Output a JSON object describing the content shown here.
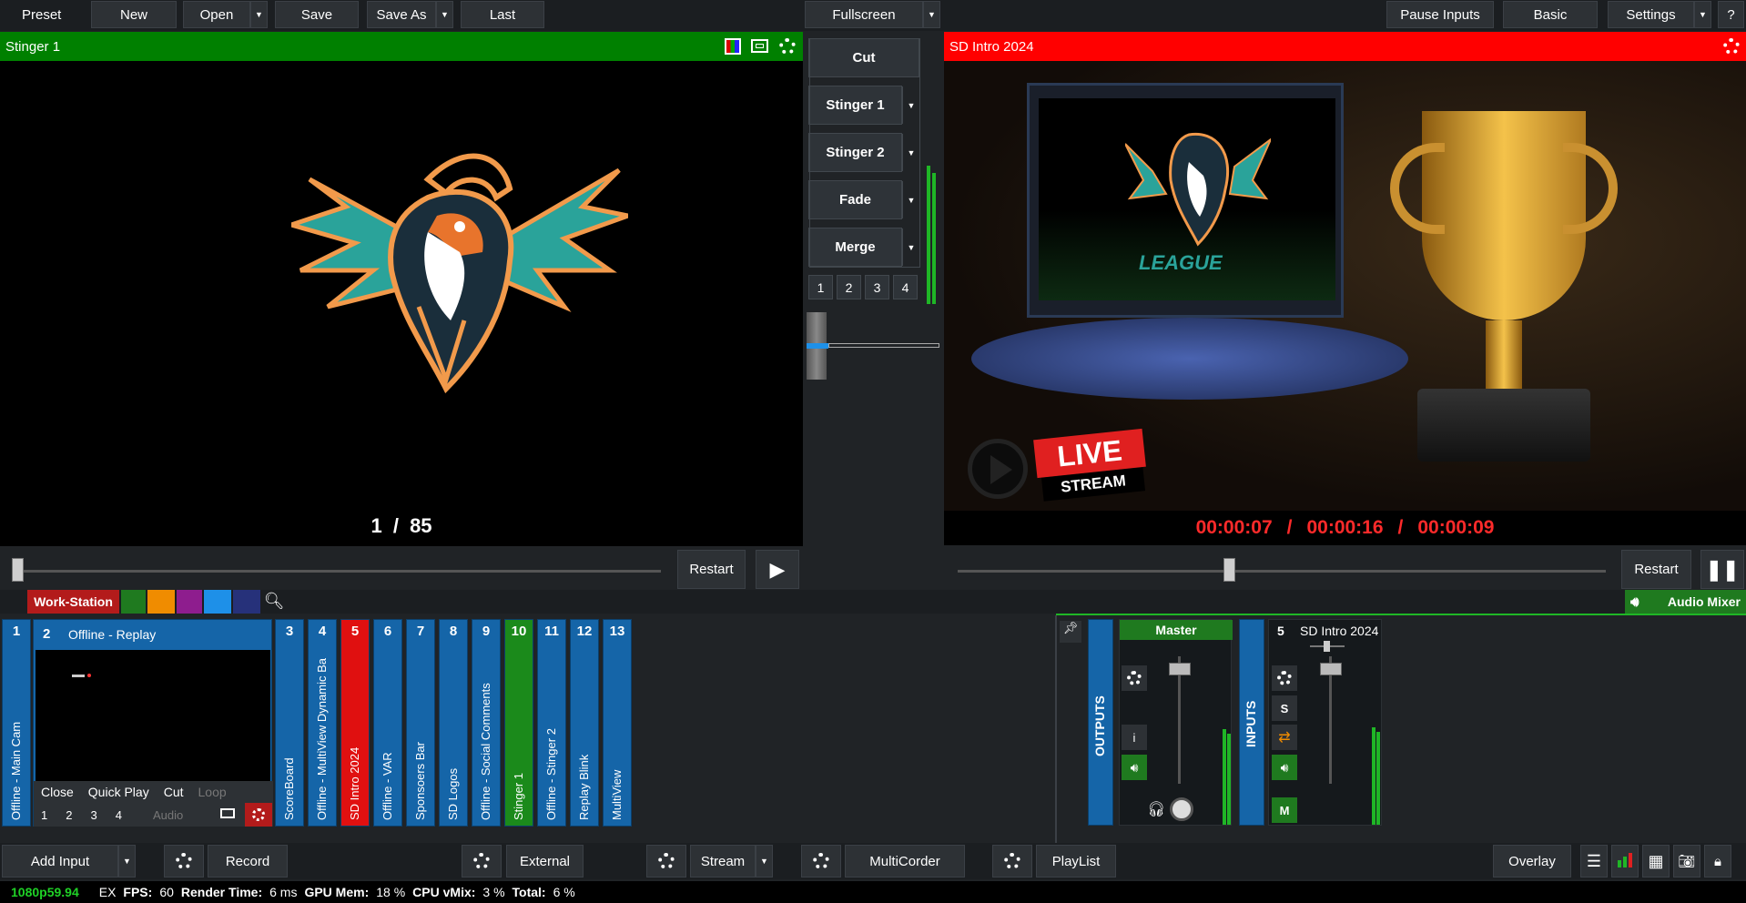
{
  "topbar": {
    "preset": "Preset",
    "new": "New",
    "open": "Open",
    "save": "Save",
    "save_as": "Save As",
    "last": "Last",
    "fullscreen": "Fullscreen",
    "pause_inputs": "Pause Inputs",
    "basic": "Basic",
    "settings": "Settings",
    "help": "?"
  },
  "preview": {
    "title": "Stinger 1",
    "counter_current": "1",
    "counter_sep": "/",
    "counter_total": "85",
    "restart": "Restart",
    "header_color": "#008000"
  },
  "program": {
    "title": "SD Intro 2024",
    "time_elapsed": "00:00:07",
    "time_total": "00:00:16",
    "time_remaining": "00:00:09",
    "sep": "/",
    "restart": "Restart",
    "header_color": "#ff0000",
    "scene_league": "LEAGUE",
    "scene_live": "LIVE",
    "scene_stream": "STREAM"
  },
  "transitions": {
    "cut": "Cut",
    "stinger1": "Stinger 1",
    "stinger2": "Stinger 2",
    "fade": "Fade",
    "merge": "Merge",
    "n1": "1",
    "n2": "2",
    "n3": "3",
    "n4": "4"
  },
  "tabs": {
    "workstation": "Work-Station",
    "audio_mixer": "Audio Mixer",
    "colors": [
      "#1f7a1f",
      "#f08c00",
      "#8e1d8e",
      "#1e90e8",
      "#26317a"
    ]
  },
  "inputs": {
    "input1": {
      "num": "1",
      "label": "Offline - Main Cam"
    },
    "input2": {
      "num": "2",
      "label": "Offline - Replay",
      "close": "Close",
      "quick_play": "Quick Play",
      "cut": "Cut",
      "loop": "Loop",
      "o1": "1",
      "o2": "2",
      "o3": "3",
      "o4": "4",
      "audio": "Audio"
    },
    "tiles": [
      {
        "num": "3",
        "label": "ScoreBoard",
        "color": "#1565a8"
      },
      {
        "num": "4",
        "label": "Offline - MultiView Dynamic Ba",
        "color": "#1565a8"
      },
      {
        "num": "5",
        "label": "SD Intro 2024",
        "color": "#e01010"
      },
      {
        "num": "6",
        "label": "Offline - VAR",
        "color": "#1565a8"
      },
      {
        "num": "7",
        "label": "Sponsoers Bar",
        "color": "#1565a8"
      },
      {
        "num": "8",
        "label": "SD Logos",
        "color": "#1565a8"
      },
      {
        "num": "9",
        "label": "Offline - Social Comments",
        "color": "#1565a8"
      },
      {
        "num": "10",
        "label": "Stinger 1",
        "color": "#1b8a1b"
      },
      {
        "num": "11",
        "label": "Offline - Stinger 2",
        "color": "#1565a8"
      },
      {
        "num": "12",
        "label": "Replay Blink",
        "color": "#1565a8"
      },
      {
        "num": "13",
        "label": "MultiView",
        "color": "#1565a8"
      }
    ]
  },
  "mixer": {
    "outputs": "OUTPUTS",
    "inputs": "INPUTS",
    "master": "Master",
    "channel_num": "5",
    "channel_name": "SD Intro 2024",
    "i": "i",
    "s": "S",
    "m": "M"
  },
  "bottombar": {
    "add_input": "Add Input",
    "record": "Record",
    "external": "External",
    "stream": "Stream",
    "multicorder": "MultiCorder",
    "playlist": "PlayList",
    "overlay": "Overlay"
  },
  "status": {
    "format": "1080p59.94",
    "ex": "EX",
    "fps_label": "FPS:",
    "fps": "60",
    "render_label": "Render Time:",
    "render": "6 ms",
    "gpu_label": "GPU Mem:",
    "gpu": "18 %",
    "cpu_label": "CPU vMix:",
    "cpu": "3 %",
    "total_label": "Total:",
    "total": "6 %"
  }
}
